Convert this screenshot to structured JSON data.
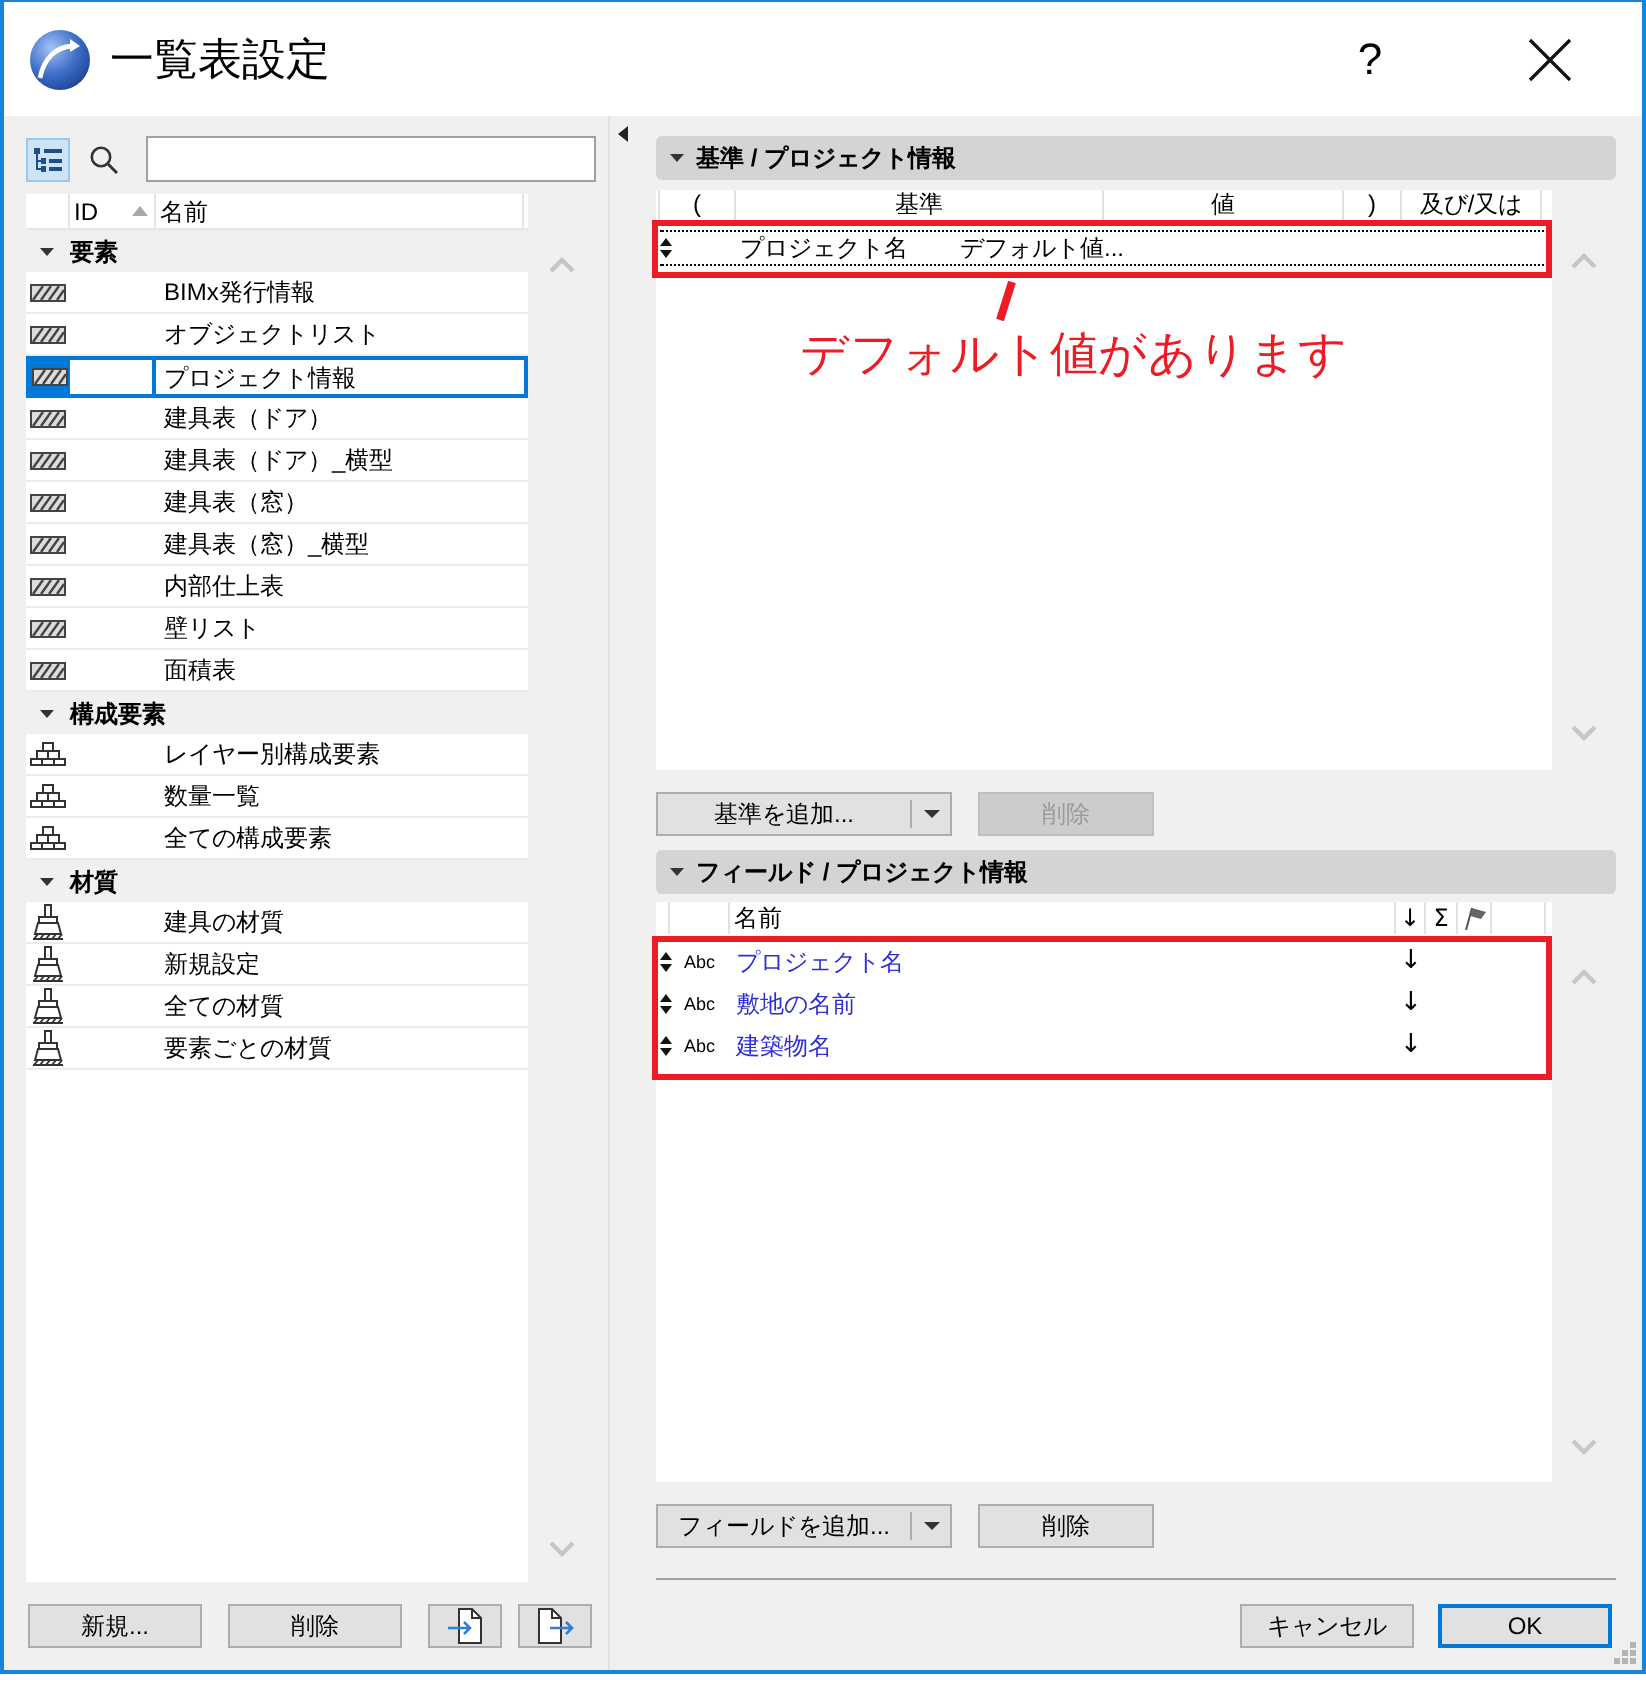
{
  "window": {
    "title": "一覧表設定",
    "help_label": "?"
  },
  "left_panel": {
    "view_toggle": {
      "on": true
    },
    "columns": [
      {
        "label": "ID",
        "sorted": true
      },
      {
        "label": "名前",
        "sorted": false
      }
    ],
    "groups": [
      {
        "label": "要素",
        "kind": "element",
        "expanded": true,
        "items": [
          {
            "name": "BIMx発行情報",
            "selected": false
          },
          {
            "name": "オブジェクトリスト",
            "selected": false
          },
          {
            "name": "プロジェクト情報",
            "selected": true
          },
          {
            "name": "建具表（ドア）",
            "selected": false
          },
          {
            "name": "建具表（ドア）_横型",
            "selected": false
          },
          {
            "name": "建具表（窓）",
            "selected": false
          },
          {
            "name": "建具表（窓）_横型",
            "selected": false
          },
          {
            "name": "内部仕上表",
            "selected": false
          },
          {
            "name": "壁リスト",
            "selected": false
          },
          {
            "name": "面積表",
            "selected": false
          }
        ]
      },
      {
        "label": "構成要素",
        "kind": "component",
        "expanded": true,
        "items": [
          {
            "name": "レイヤー別構成要素",
            "selected": false
          },
          {
            "name": "数量一覧",
            "selected": false
          },
          {
            "name": "全ての構成要素",
            "selected": false
          }
        ]
      },
      {
        "label": "材質",
        "kind": "material",
        "expanded": true,
        "items": [
          {
            "name": "建具の材質",
            "selected": false
          },
          {
            "name": "新規設定",
            "selected": false
          },
          {
            "name": "全ての材質",
            "selected": false
          },
          {
            "name": "要素ごとの材質",
            "selected": false
          }
        ]
      }
    ],
    "buttons": [
      {
        "kind": "text",
        "label": "新規..."
      },
      {
        "kind": "text",
        "label": "削除"
      },
      {
        "kind": "import"
      },
      {
        "kind": "export"
      }
    ]
  },
  "criteria": {
    "title": "基準 / プロジェクト情報",
    "expanded": true,
    "columns": [
      "(",
      "基準",
      "値",
      ")",
      "及び/又は"
    ],
    "rows": [
      {
        "criterion": "プロジェクト名",
        "value": "デフォルト値...",
        "selected": true
      }
    ],
    "annotation": "デフォルト値があります",
    "add_button": "基準を追加...",
    "delete_button": {
      "label": "削除",
      "disabled": true
    }
  },
  "fields": {
    "title": "フィールド / プロジェクト情報",
    "expanded": true,
    "columns": [
      {
        "kind": "text",
        "label": "名前"
      },
      {
        "kind": "text",
        "label": "↓"
      },
      {
        "kind": "text",
        "label": "Σ"
      },
      {
        "kind": "flag"
      }
    ],
    "rows": [
      {
        "type_label": "Abc",
        "name": "プロジェクト名",
        "sort": "↓"
      },
      {
        "type_label": "Abc",
        "name": "敷地の名前",
        "sort": "↓"
      },
      {
        "type_label": "Abc",
        "name": "建築物名",
        "sort": "↓"
      }
    ],
    "add_button": "フィールドを追加...",
    "delete_button": {
      "label": "削除",
      "disabled": false
    }
  },
  "footer": {
    "buttons": [
      {
        "label": "キャンセル",
        "default": false
      },
      {
        "label": "OK",
        "default": true
      }
    ]
  }
}
